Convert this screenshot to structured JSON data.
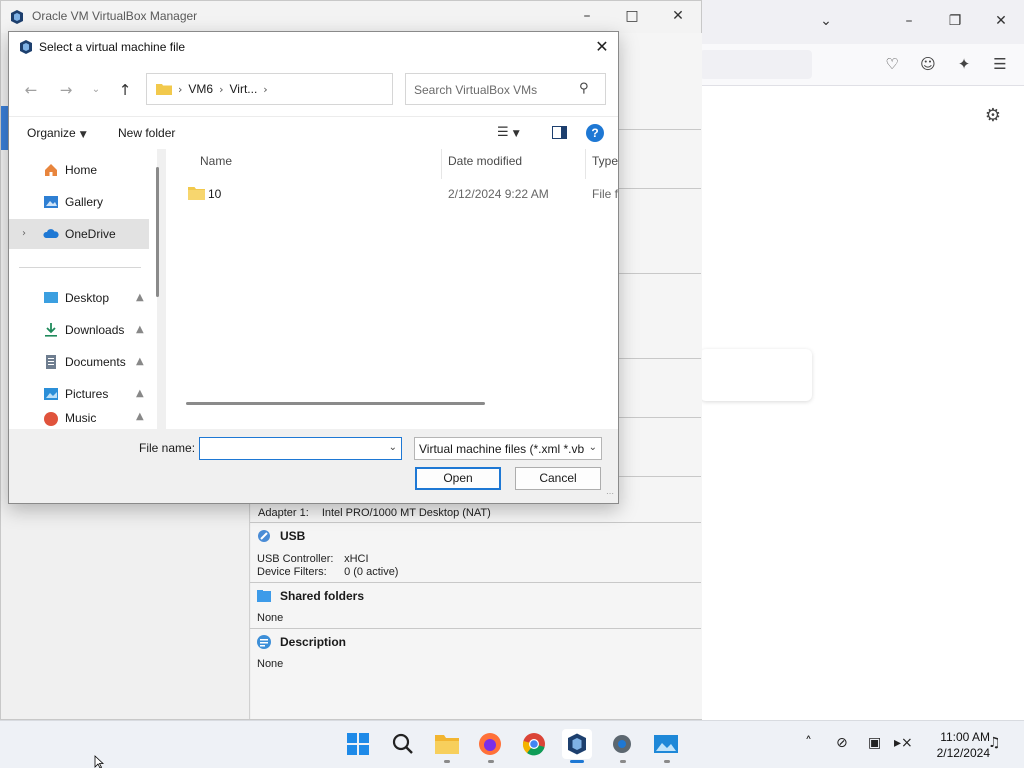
{
  "vbox_manager": {
    "window_title": "Oracle VM VirtualBox Manager",
    "network_detail": {
      "key": "Adapter 1:",
      "value": "Intel PRO/1000 MT Desktop (NAT)"
    },
    "usb": {
      "title": "USB",
      "rows": [
        {
          "key": "USB Controller:",
          "value": "xHCI"
        },
        {
          "key": "Device Filters:",
          "value": "0 (0 active)"
        }
      ]
    },
    "shared_folders": {
      "title": "Shared folders",
      "value": "None"
    },
    "description": {
      "title": "Description",
      "value": "None"
    }
  },
  "dialog": {
    "title": "Select a virtual machine file",
    "breadcrumb": [
      "VM6",
      "Virt..."
    ],
    "search_placeholder": "Search VirtualBox VMs",
    "commands": {
      "organize": "Organize",
      "new_folder": "New folder"
    },
    "nav_items": [
      {
        "label": "Home",
        "icon": "home-icon"
      },
      {
        "label": "Gallery",
        "icon": "gallery-icon"
      },
      {
        "label": "OneDrive",
        "icon": "cloud-icon",
        "selected": true
      },
      {
        "label": "Desktop",
        "icon": "desktop-icon",
        "pinned": true
      },
      {
        "label": "Downloads",
        "icon": "download-icon",
        "pinned": true
      },
      {
        "label": "Documents",
        "icon": "documents-icon",
        "pinned": true
      },
      {
        "label": "Pictures",
        "icon": "pictures-icon",
        "pinned": true
      },
      {
        "label": "Music",
        "icon": "music-icon",
        "pinned": true
      }
    ],
    "columns": {
      "name": "Name",
      "date": "Date modified",
      "type": "Type"
    },
    "files": [
      {
        "name": "10",
        "date": "2/12/2024 9:22 AM",
        "type": "File fo"
      }
    ],
    "file_name_label": "File name:",
    "file_name_value": "",
    "file_type": "Virtual machine files (*.xml *.vb",
    "open_label": "Open",
    "cancel_label": "Cancel"
  },
  "taskbar": {
    "apps": [
      "start-icon",
      "search-icon",
      "file-explorer-icon",
      "firefox-icon",
      "chrome-icon",
      "virtualbox-icon",
      "settings-icon",
      "photos-icon"
    ],
    "time": "11:00 AM",
    "date": "2/12/2024"
  },
  "colors": {
    "accent": "#1e78d4",
    "vbox_blue": "#1d3f6e",
    "folder_yellow": "#f2c94c"
  }
}
